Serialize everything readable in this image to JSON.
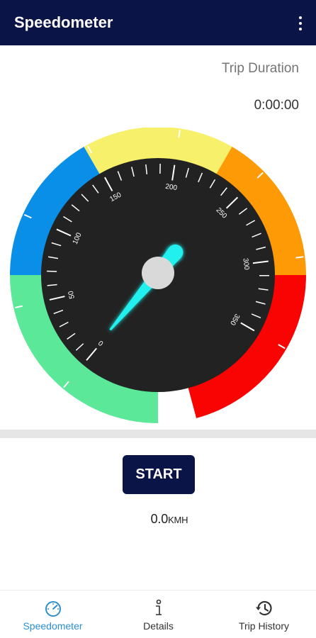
{
  "app_bar": {
    "title": "Speedometer",
    "menu_icon": "more-vert-icon",
    "background": "#0a1446"
  },
  "trip": {
    "label": "Trip Duration",
    "value": "0:00:00"
  },
  "gauge": {
    "tick_labels": [
      "0",
      "50",
      "100",
      "150",
      "200",
      "250",
      "300",
      "350"
    ],
    "min": 0,
    "max": 350,
    "current_speed": 0.0,
    "needle_color": "#22f0ee",
    "dial_color": "#222222",
    "zone_colors": [
      "#5be898",
      "#0a8fe8",
      "#f7f06a",
      "#fe9a05",
      "#f90303"
    ],
    "readout_value": "0.0",
    "readout_unit": "KMH"
  },
  "controls": {
    "start_label": "START"
  },
  "bottom_nav": {
    "active_color": "#2d8fd0",
    "items": [
      {
        "label": "Speedometer",
        "icon": "speedometer-icon",
        "active": true
      },
      {
        "label": "Details",
        "icon": "info-icon",
        "active": false
      },
      {
        "label": "Trip History",
        "icon": "history-icon",
        "active": false
      }
    ]
  }
}
